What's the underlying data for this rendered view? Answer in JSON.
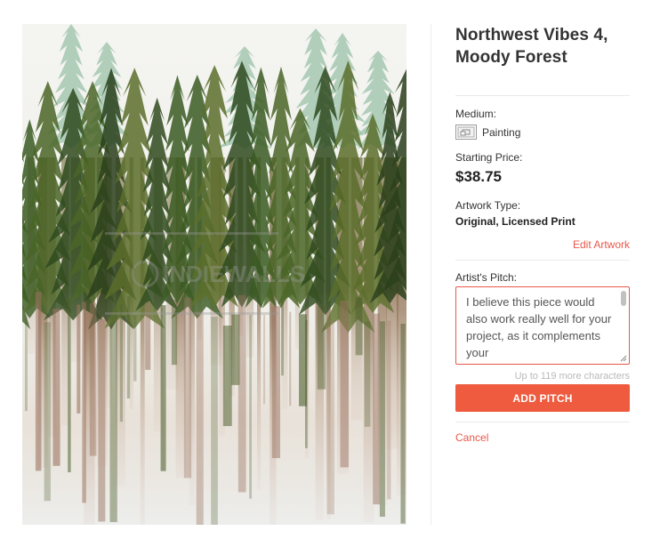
{
  "artwork": {
    "image_alt": "Watercolor painting of a dark green evergreen forest with dripping brown trunks",
    "watermark": "INDIEWALLS"
  },
  "details": {
    "title": "Northwest Vibes 4,\nMoody Forest",
    "medium_label": "Medium:",
    "medium_value": "Painting",
    "medium_icon": "painting-icon",
    "price_label": "Starting Price:",
    "price_value": "$38.75",
    "type_label": "Artwork Type:",
    "type_value": "Original, Licensed Print",
    "edit_link": "Edit Artwork"
  },
  "pitch": {
    "label": "Artist's Pitch:",
    "text": "I believe this piece would also work really well for your project, as it complements your",
    "counter": "Up to 119 more characters",
    "add_button": "ADD PITCH",
    "cancel_link": "Cancel"
  },
  "colors": {
    "accent": "#ee5b3f",
    "link": "#e8584a"
  }
}
